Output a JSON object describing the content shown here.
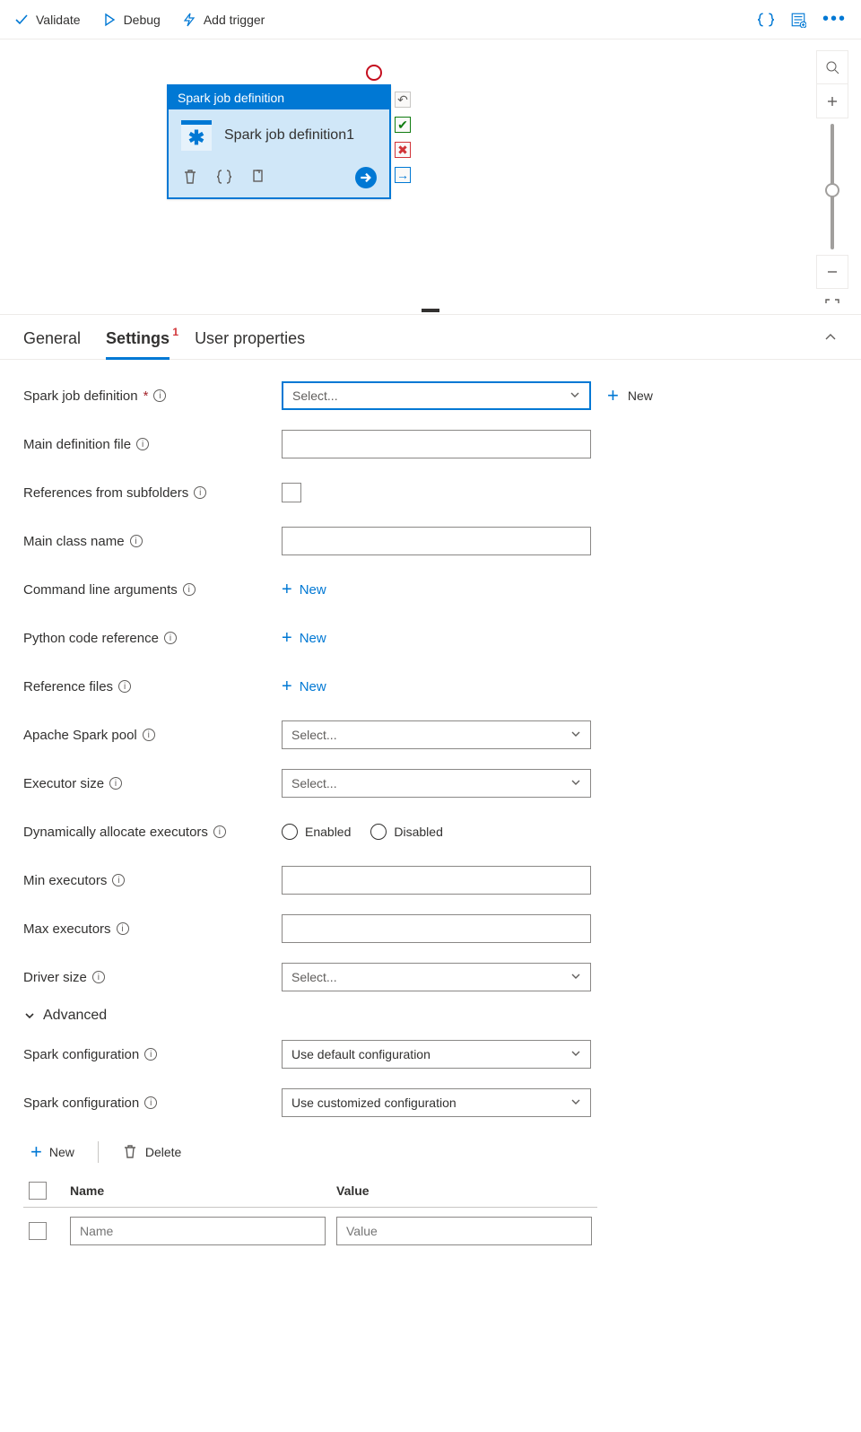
{
  "toolbar": {
    "validate": "Validate",
    "debug": "Debug",
    "add_trigger": "Add trigger"
  },
  "activity": {
    "header": "Spark job definition",
    "name": "Spark job definition1"
  },
  "tabs": {
    "general": "General",
    "settings": "Settings",
    "settings_badge": "1",
    "user_properties": "User properties"
  },
  "form": {
    "spark_job_def_label": "Spark job definition",
    "main_def_file_label": "Main definition file",
    "refs_subfolders_label": "References from subfolders",
    "main_class_label": "Main class name",
    "cmd_args_label": "Command line arguments",
    "py_ref_label": "Python code reference",
    "ref_files_label": "Reference files",
    "spark_pool_label": "Apache Spark pool",
    "executor_size_label": "Executor size",
    "dyn_alloc_label": "Dynamically allocate executors",
    "enabled": "Enabled",
    "disabled": "Disabled",
    "min_exec_label": "Min executors",
    "max_exec_label": "Max executors",
    "driver_size_label": "Driver size",
    "advanced": "Advanced",
    "spark_config_label": "Spark configuration",
    "select_ph": "Select...",
    "new_label": "New",
    "default_cfg": "Use default configuration",
    "custom_cfg": "Use customized configuration"
  },
  "cfg_table": {
    "new": "New",
    "delete": "Delete",
    "col_name": "Name",
    "col_value": "Value",
    "name_ph": "Name",
    "value_ph": "Value"
  }
}
